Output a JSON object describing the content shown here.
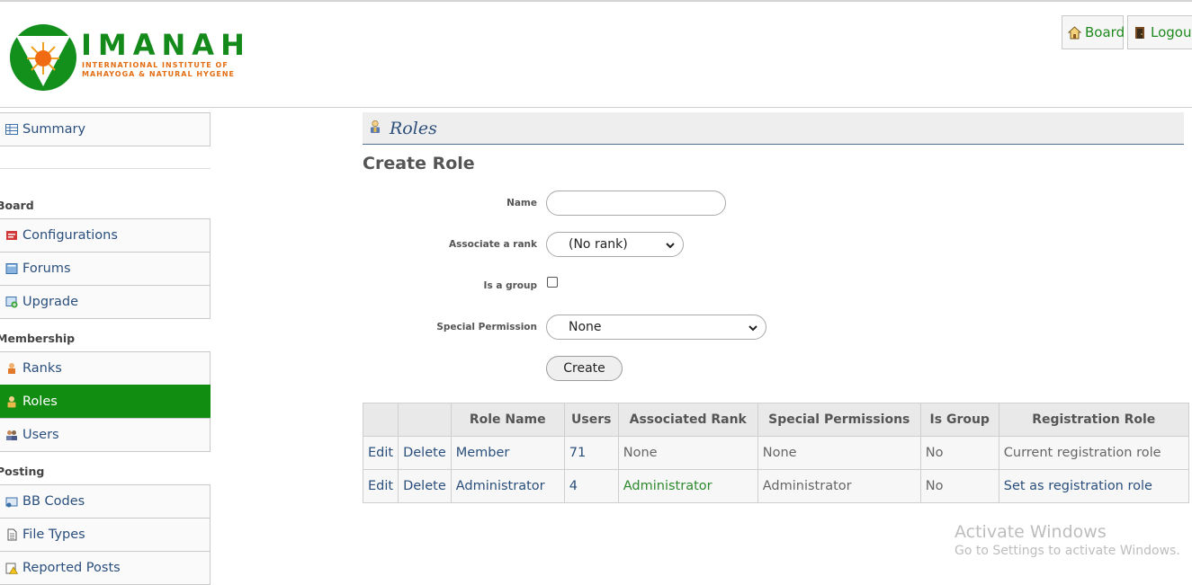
{
  "logo": {
    "word": "IMANAH",
    "sub_line1": "INTERNATIONAL INSTITUTE OF",
    "sub_line2": "MAHAYOGA & NATURAL HYGENE"
  },
  "header": {
    "board_label": "Board",
    "logout_label": "Logout"
  },
  "sidebar": {
    "summary": "Summary",
    "board_head": "Board",
    "configurations": "Configurations",
    "forums": "Forums",
    "upgrade": "Upgrade",
    "membership_head": "Membership",
    "ranks": "Ranks",
    "roles": "Roles",
    "users": "Users",
    "posting_head": "Posting",
    "bb_codes": "BB Codes",
    "file_types": "File Types",
    "reported_posts": "Reported Posts"
  },
  "main": {
    "section_title": "Roles",
    "form_title": "Create Role",
    "form": {
      "name_label": "Name",
      "name_value": "",
      "rank_label": "Associate a rank",
      "rank_selected": "(No rank)",
      "group_label": "Is a group",
      "is_group_checked": false,
      "perm_label": "Special Permission",
      "perm_selected": "None",
      "create_button": "Create"
    },
    "table": {
      "columns": [
        "",
        "",
        "Role Name",
        "Users",
        "Associated Rank",
        "Special Permissions",
        "Is Group",
        "Registration Role"
      ],
      "rows": [
        {
          "edit": "Edit",
          "delete": "Delete",
          "name": "Member",
          "users": "71",
          "rank": "None",
          "perms": "None",
          "is_group": "No",
          "registration": "Current registration role"
        },
        {
          "edit": "Edit",
          "delete": "Delete",
          "name": "Administrator",
          "users": "4",
          "rank": "Administrator",
          "perms": "Administrator",
          "is_group": "No",
          "registration": "Set as registration role"
        }
      ]
    }
  },
  "watermark": {
    "line1": "Activate Windows",
    "line2": "Go to Settings to activate Windows."
  },
  "colors": {
    "brand_green": "#118d11",
    "link_blue": "#2a4f7c",
    "logo_orange": "#e36d12"
  }
}
